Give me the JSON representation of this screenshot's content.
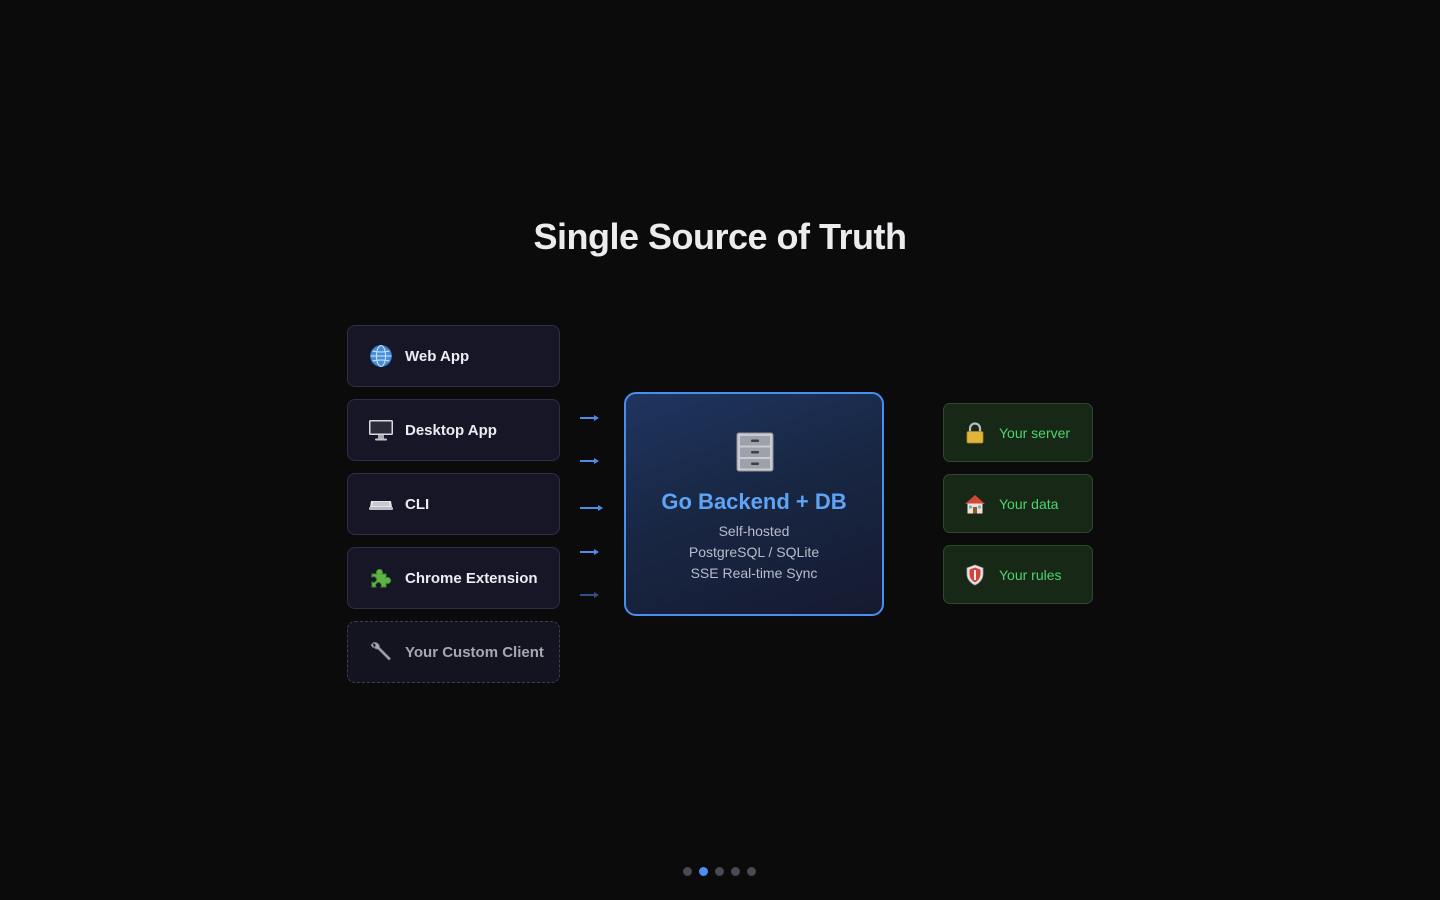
{
  "slide": {
    "title": "Single Source of Truth"
  },
  "clients": [
    {
      "label": "Web App",
      "icon": "globe-icon"
    },
    {
      "label": "Desktop App",
      "icon": "desktop-icon"
    },
    {
      "label": "CLI",
      "icon": "keyboard-icon"
    },
    {
      "label": "Chrome Extension",
      "icon": "puzzle-icon"
    },
    {
      "label": "Your Custom Client",
      "icon": "wrench-icon"
    }
  ],
  "backend": {
    "name": "Go Backend + DB",
    "icon": "file-cabinet-icon",
    "details": [
      "Self-hosted",
      "PostgreSQL / SQLite",
      "SSE Real-time Sync"
    ]
  },
  "ownership": [
    {
      "label": "Your server",
      "icon": "lock-icon"
    },
    {
      "label": "Your data",
      "icon": "house-icon"
    },
    {
      "label": "Your rules",
      "icon": "shield-icon"
    }
  ],
  "pager": {
    "total": 5,
    "current": 2
  },
  "colors": {
    "background": "#0b0b0c",
    "accent": "#4a8ef0",
    "ownership_text": "#4fd36f",
    "backend_title": "#5fa3f5"
  }
}
